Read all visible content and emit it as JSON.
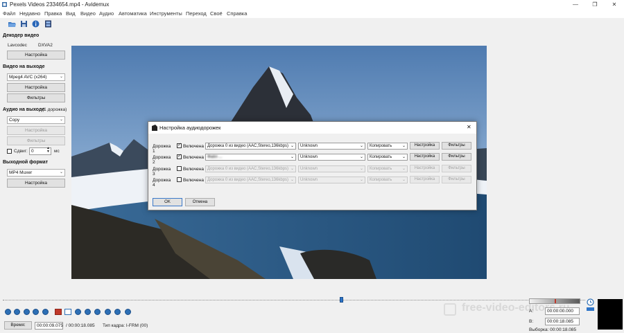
{
  "window": {
    "title": "Pexels Videos 2334654.mp4 - Avidemux",
    "controls": {
      "minimize": "—",
      "maximize": "❐",
      "close": "✕"
    }
  },
  "menu": [
    "Файл",
    "Недавно",
    "Правка",
    "Вид",
    "Видео",
    "Аудио",
    "Автоматика",
    "Инструменты",
    "Переход",
    "Своё",
    "Справка"
  ],
  "toolbar": [
    "open-file-icon",
    "save-file-icon",
    "info-icon",
    "film-properties-icon"
  ],
  "left_panel": {
    "decoder_title": "Декодер видео",
    "decoder_lavcodec": "Lavcodec",
    "decoder_dxva": "DXVA2",
    "decoder_settings": "Настройка",
    "video_out_title": "Видео на выходе",
    "video_codec": "Mpeg4 AVC (x264)",
    "video_settings": "Настройка",
    "video_filters": "Фильтры",
    "audio_out_title": "Аудио на выходе",
    "audio_out_count": "(1 дорожка)",
    "audio_codec": "Copy",
    "audio_settings": "Настройка",
    "audio_filters": "Фильтры",
    "shift_label": "Сдвиг:",
    "shift_value": "0",
    "shift_unit": "мс",
    "format_title": "Выходной формат",
    "format_value": "MP4 Muxer",
    "format_settings": "Настройка"
  },
  "dialog": {
    "title": "Настройка аудиодорожек",
    "close": "✕",
    "tracks": [
      {
        "label": "Дорожка 1",
        "enabled_label": "Включена",
        "checked": true,
        "source": "Дорожка 0 из видео (AAC,Stereo,136kbps)",
        "lang": "Unknown",
        "mode": "Копировать",
        "settings": "Настройка",
        "filters": "Фильтры",
        "disabled": false,
        "blurred": false
      },
      {
        "label": "Дорожка 2",
        "enabled_label": "Включена",
        "checked": true,
        "source": "Файл ...",
        "lang": "Unknown",
        "mode": "Копировать",
        "settings": "Настройка",
        "filters": "Фильтры",
        "disabled": false,
        "blurred": true
      },
      {
        "label": "Дорожка 3",
        "enabled_label": "Включена",
        "checked": false,
        "source": "Дорожка 0 из видео (AAC,Stereo,136kbps)",
        "lang": "Unknown",
        "mode": "Копировать",
        "settings": "Настройка",
        "filters": "Фильтры",
        "disabled": true,
        "blurred": false
      },
      {
        "label": "Дорожка 4",
        "enabled_label": "Включена",
        "checked": false,
        "source": "Дорожка 0 из видео (AAC,Stereo,136kbps)",
        "lang": "Unknown",
        "mode": "Копировать",
        "settings": "Настройка",
        "filters": "Фильтры",
        "disabled": true,
        "blurred": false
      }
    ],
    "ok": "OK",
    "cancel": "Отмена"
  },
  "timeline": {
    "position_fraction": 0.6
  },
  "statusbar": {
    "time_label": "Время:",
    "current_time": "00:00:09.075",
    "total_time": "/ 00:00:18.085",
    "frame_type": "Тип кадра:  I-FRM (00)"
  },
  "selection": {
    "a_label": "A:",
    "a_value": "00:00:00.000",
    "b_label": "B:",
    "b_value": "00:00:18.085",
    "selection_label": "Выборка: 00:00:18.085"
  },
  "watermark": "free-video-editors.ru",
  "colors": {
    "accent": "#2d6fb5",
    "sky": "#5d86b5",
    "fog": "#e4ebf3"
  }
}
